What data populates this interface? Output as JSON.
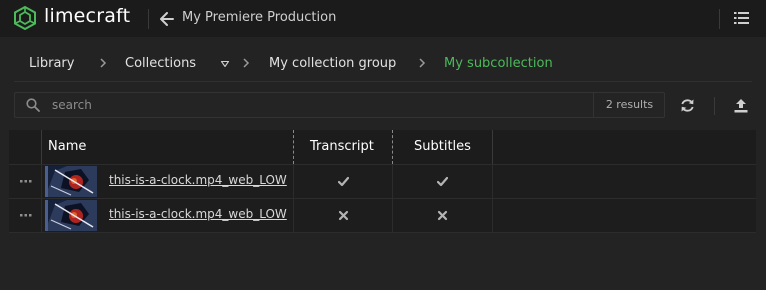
{
  "app": {
    "brand": "limecraft",
    "production_title": "My Premiere Production"
  },
  "breadcrumb": {
    "items": [
      {
        "label": "Library"
      },
      {
        "label": "Collections",
        "dropdown": true
      },
      {
        "label": "My collection group"
      },
      {
        "label": "My subcollection",
        "active": true
      }
    ]
  },
  "search": {
    "placeholder": "search",
    "value": "",
    "results_text": "2 results"
  },
  "table": {
    "columns": [
      "Name",
      "Transcript",
      "Subtitles"
    ],
    "rows": [
      {
        "name": "this-is-a-clock.mp4_web_LOW",
        "transcript": "check",
        "subtitles": "check"
      },
      {
        "name": "this-is-a-clock.mp4_web_LOW",
        "transcript": "cross",
        "subtitles": "cross"
      }
    ]
  },
  "colors": {
    "accent": "#4cba5b",
    "background": "#232323",
    "topbar": "#1b1b1b"
  },
  "icons": [
    "limecraft-logo-icon",
    "back-arrow-icon",
    "list-menu-icon",
    "chevron-right-icon",
    "dropdown-triangle-icon",
    "search-icon",
    "refresh-icon",
    "upload-icon",
    "row-menu-dots-icon",
    "checkmark-icon",
    "cross-icon"
  ]
}
